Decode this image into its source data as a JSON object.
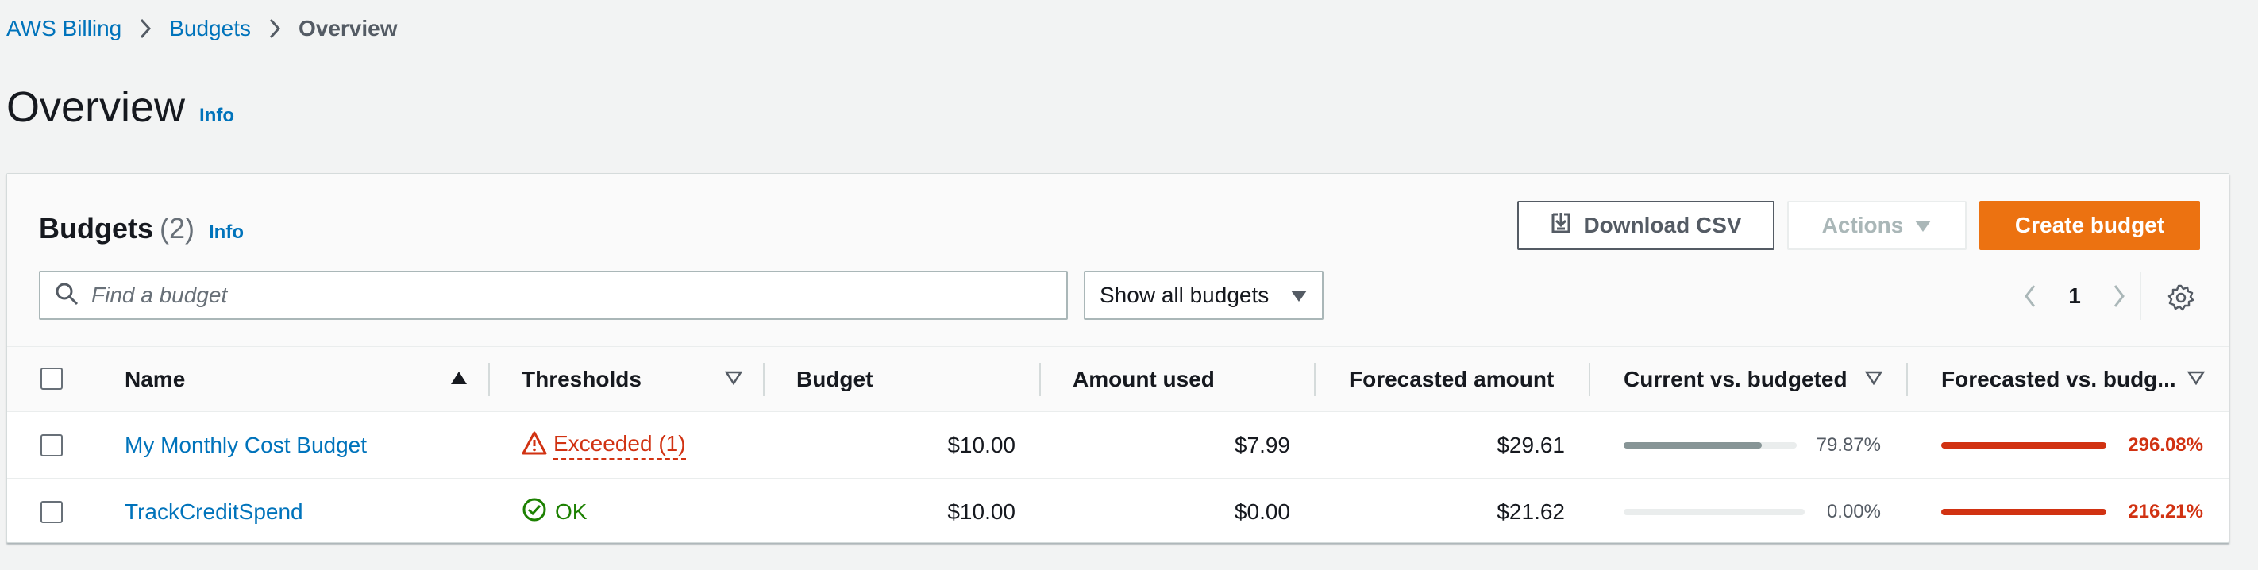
{
  "breadcrumb": [
    "AWS Billing",
    "Budgets",
    "Overview"
  ],
  "page": {
    "title": "Overview",
    "info": "Info"
  },
  "section": {
    "title": "Budgets",
    "count": "(2)",
    "info": "Info"
  },
  "toolbar": {
    "download_label": "Download CSV",
    "actions_label": "Actions",
    "create_label": "Create budget"
  },
  "search": {
    "placeholder": "Find a budget"
  },
  "filter": {
    "selected": "Show all budgets"
  },
  "pagination": {
    "page": "1"
  },
  "columns": [
    "Name",
    "Thresholds",
    "Budget",
    "Amount used",
    "Forecasted amount",
    "Current vs. budgeted",
    "Forecasted vs. budg..."
  ],
  "rows": [
    {
      "name": "My Monthly Cost Budget",
      "threshold": "Exceeded (1)",
      "threshold_status": "exceeded",
      "budget": "$10.00",
      "amount_used": "$7.99",
      "forecasted": "$29.61",
      "current_vs_budgeted": "79.87%",
      "current_fraction": 0.7987,
      "forecast_vs_budgeted": "296.08%",
      "forecast_fraction": 1.0
    },
    {
      "name": "TrackCreditSpend",
      "threshold": "OK",
      "threshold_status": "ok",
      "budget": "$10.00",
      "amount_used": "$0.00",
      "forecasted": "$21.62",
      "current_vs_budgeted": "0.00%",
      "current_fraction": 0.0,
      "forecast_vs_budgeted": "216.21%",
      "forecast_fraction": 1.0
    }
  ],
  "colors": {
    "link": "#0073bb",
    "primary": "#ec7211",
    "danger": "#d13212",
    "success": "#1d8102",
    "bar_neutral": "#879596"
  }
}
